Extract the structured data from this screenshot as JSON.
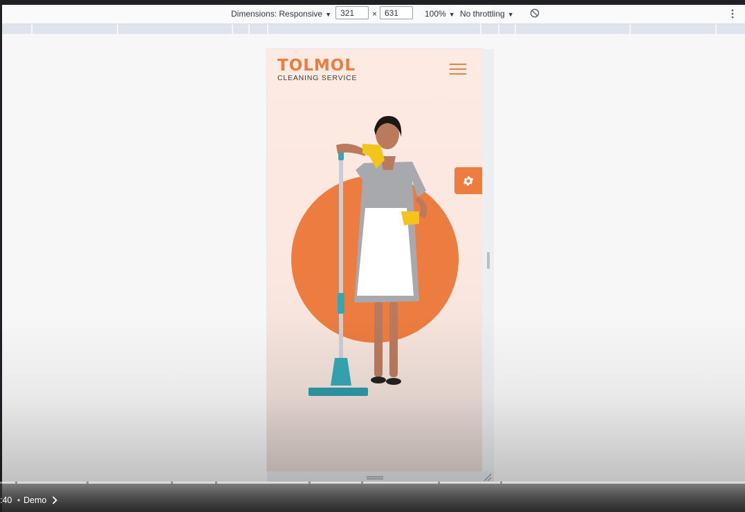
{
  "toolbar": {
    "dimensions_label": "Dimensions: Responsive",
    "width_value": "321",
    "times": "×",
    "height_value": "631",
    "zoom_label": "100%",
    "throttling_label": "No throttling"
  },
  "site": {
    "logo_title": "TOLMOL",
    "logo_subtitle": "CLEANING SERVICE"
  },
  "player": {
    "time": ":40",
    "separator": "•",
    "chapter": "Demo"
  },
  "colors": {
    "accent": "#ec7c3f",
    "hero_bg": "#fdeae2",
    "mop": "#36a6b4"
  },
  "icons": {
    "menu": "hamburger-icon",
    "settings": "gear-icon",
    "rotate": "rotate-icon",
    "more": "kebab-icon"
  }
}
